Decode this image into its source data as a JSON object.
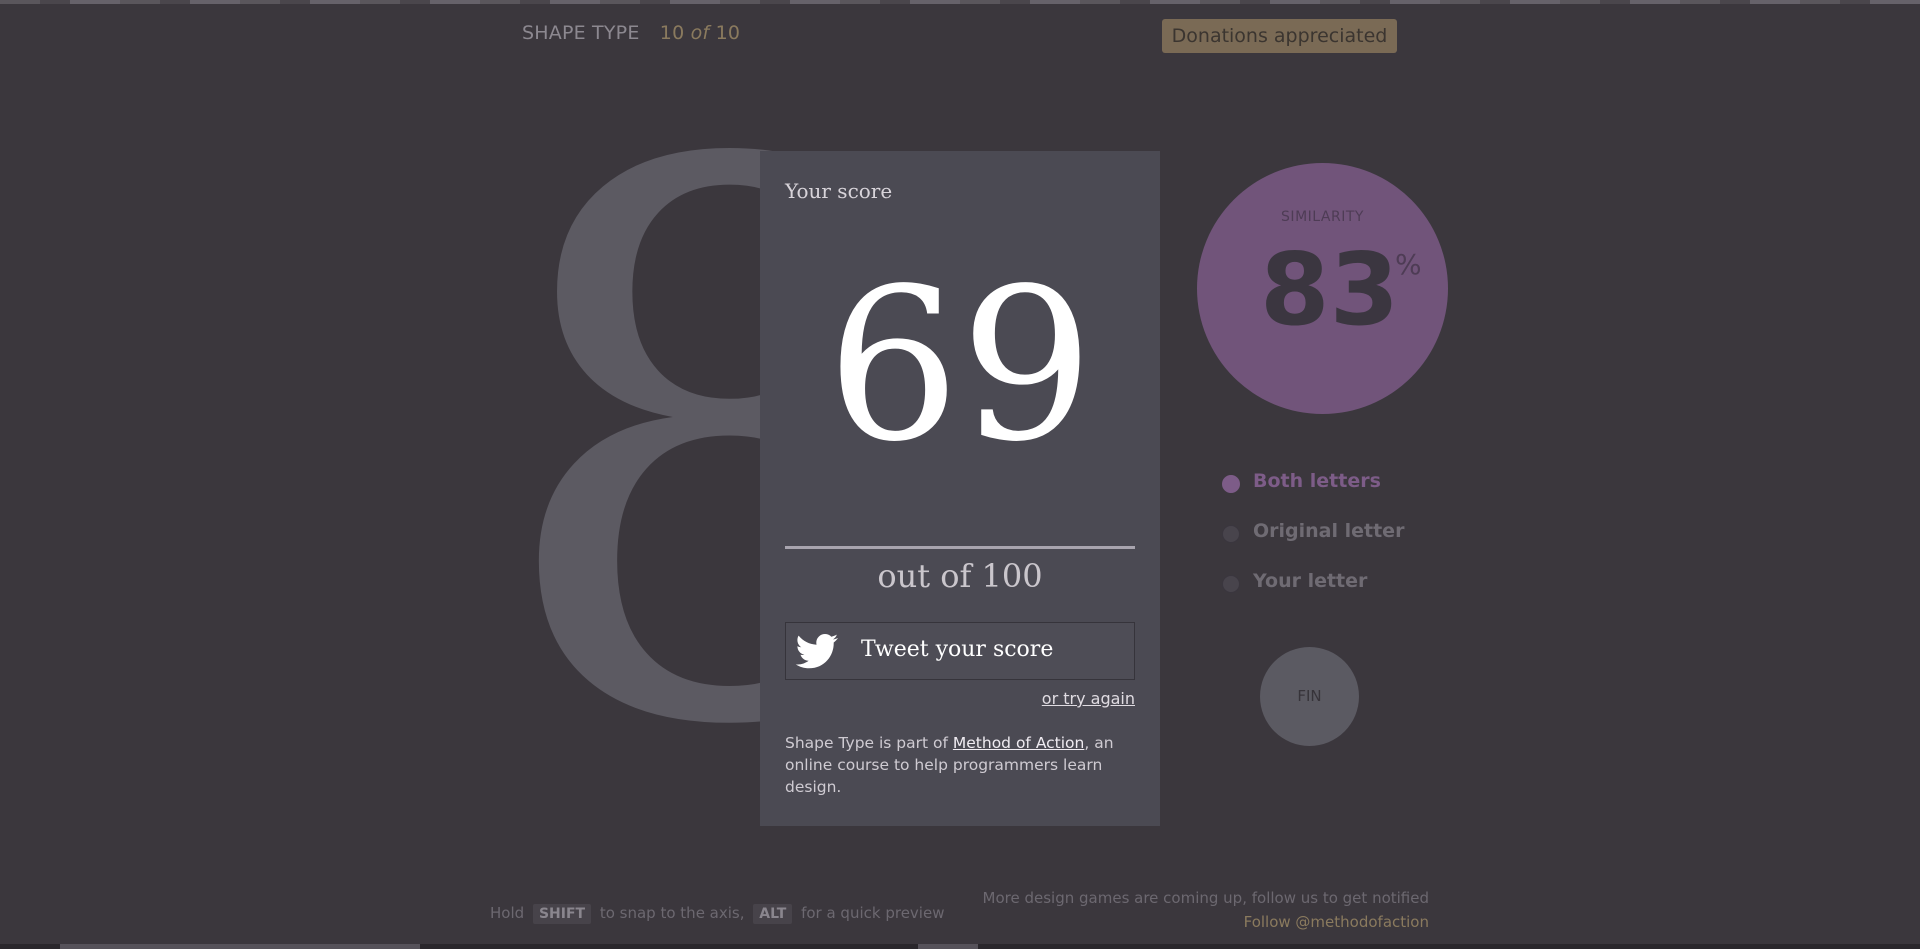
{
  "header": {
    "app_title": "SHAPE TYPE",
    "progress_current": "10",
    "progress_of": "of",
    "progress_total": "10",
    "donate_label": "Donations appreciated"
  },
  "canvas": {
    "glyph": "8"
  },
  "score_panel": {
    "heading": "Your score",
    "score": "69",
    "out_of": "out of 100",
    "tweet_label": "Tweet your score",
    "try_again_label": "or try again",
    "footnote_before": "Shape Type is part of ",
    "footnote_link": "Method of Action",
    "footnote_after": ", an online course to help programmers learn design."
  },
  "similarity": {
    "label": "SIMILARITY",
    "value": "83",
    "unit": "%"
  },
  "view_options": [
    {
      "label": "Both letters",
      "selected": true
    },
    {
      "label": "Original letter",
      "selected": false
    },
    {
      "label": "Your letter",
      "selected": false
    }
  ],
  "fin_button_label": "FIN",
  "hint": {
    "hold": "Hold",
    "shift_key": "SHIFT",
    "snap_text": "to snap to the axis,",
    "alt_key": "ALT",
    "preview_text": "for a quick preview"
  },
  "promo": {
    "line1": "More design games are coming up, follow us to get notified",
    "follow_link": "Follow @methodofaction"
  },
  "colors": {
    "background": "#3b373d",
    "panel": "#4b4a53",
    "accent_purple": "#71547a",
    "donate_gold": "#7a6a55"
  }
}
